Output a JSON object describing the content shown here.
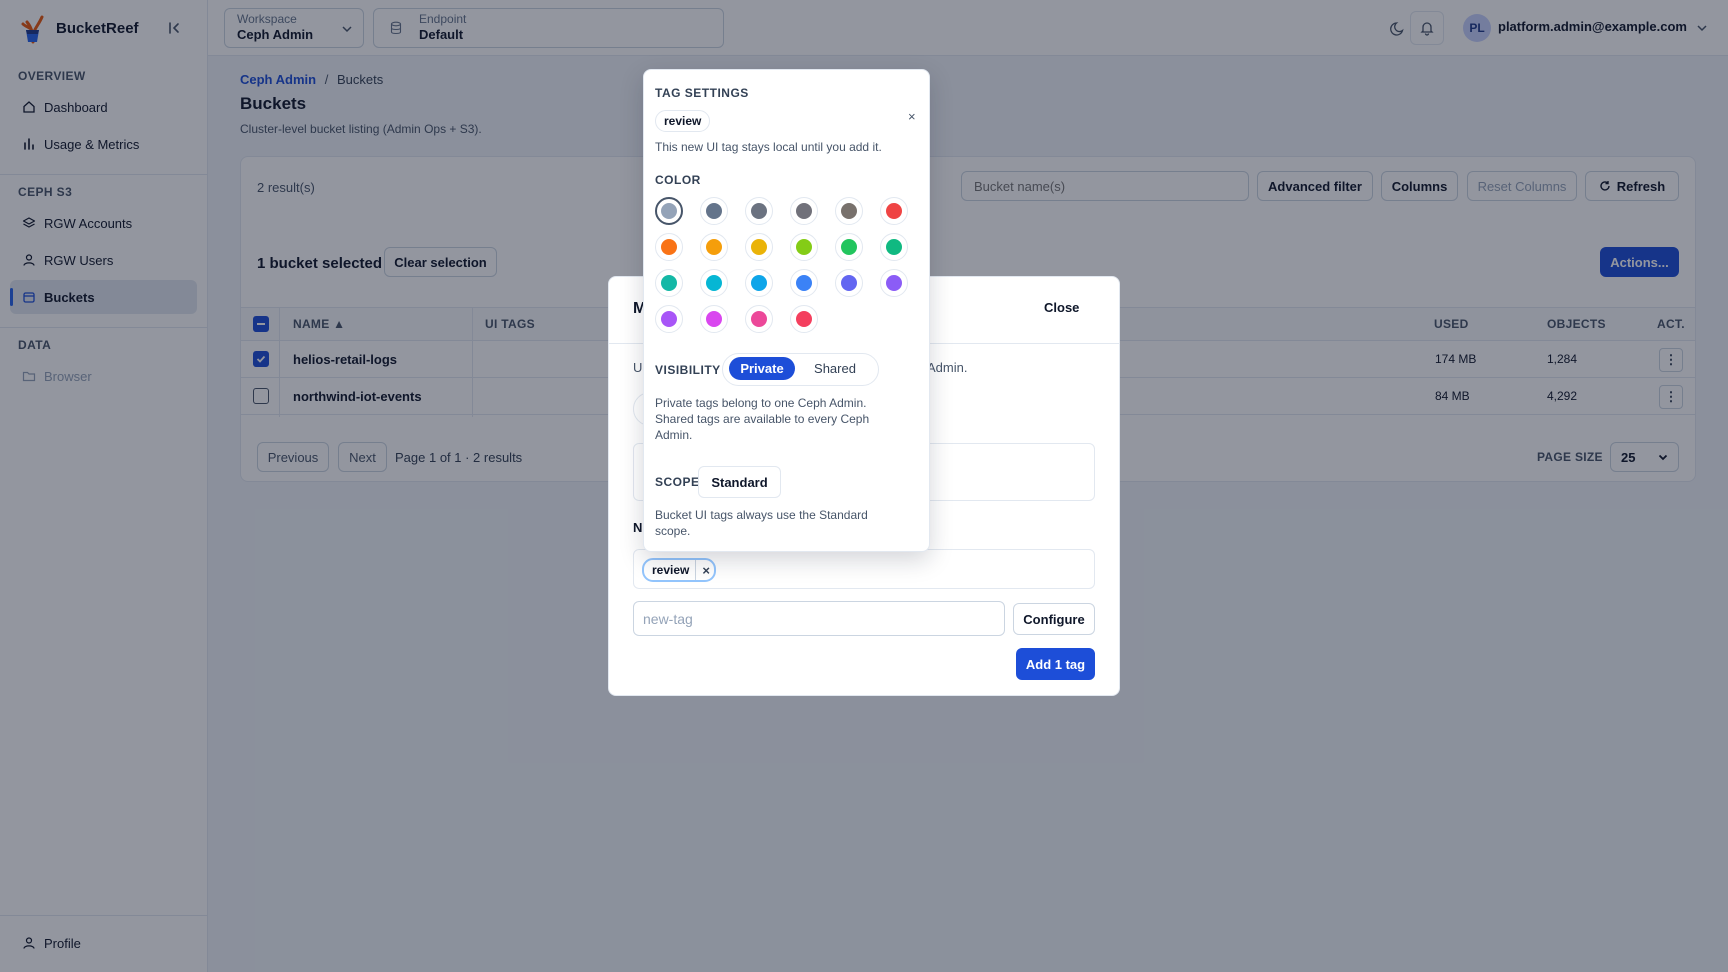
{
  "app": {
    "name": "BucketReef"
  },
  "sidebar": {
    "sections": [
      {
        "title": "OVERVIEW",
        "items": [
          {
            "label": "Dashboard"
          },
          {
            "label": "Usage & Metrics"
          }
        ]
      },
      {
        "title": "CEPH S3",
        "items": [
          {
            "label": "RGW Accounts"
          },
          {
            "label": "RGW Users"
          },
          {
            "label": "Buckets"
          }
        ]
      },
      {
        "title": "DATA",
        "items": [
          {
            "label": "Browser"
          }
        ]
      }
    ],
    "profile": "Profile"
  },
  "topbar": {
    "workspace": {
      "label": "Workspace",
      "value": "Ceph Admin"
    },
    "endpoint": {
      "label": "Endpoint",
      "value": "Default"
    },
    "user": {
      "initials": "PL",
      "email": "platform.admin@example.com"
    }
  },
  "page": {
    "breadcrumb": {
      "root": "Ceph Admin",
      "sep": "/",
      "current": "Buckets"
    },
    "title": "Buckets",
    "subtitle": "Cluster-level bucket listing (Admin Ops + S3)."
  },
  "toolbar": {
    "results": "2 result(s)",
    "search_placeholder": "Bucket name(s)",
    "advanced_filter": "Advanced filter",
    "columns": "Columns",
    "reset_columns": "Reset Columns",
    "refresh": "Refresh"
  },
  "selection": {
    "label": "1 bucket selected",
    "clear": "Clear selection",
    "actions": "Actions..."
  },
  "table": {
    "headers": {
      "name": "NAME ▲",
      "ui_tags": "UI TAGS",
      "used": "USED",
      "objects": "OBJECTS",
      "actions": "ACT."
    },
    "rows": [
      {
        "name": "helios-retail-logs",
        "used": "174 MB",
        "objects": "1,284",
        "selected": true
      },
      {
        "name": "northwind-iot-events",
        "used": "84 MB",
        "objects": "4,292",
        "selected": false
      }
    ]
  },
  "pagination": {
    "previous": "Previous",
    "next": "Next",
    "info": "Page 1 of 1 · 2 results",
    "page_size_label": "PAGE SIZE",
    "page_size": "25"
  },
  "modal": {
    "title_initial": "M",
    "close": "Close",
    "line_start": "U",
    "line_end": "Admin.",
    "new_heading_initial": "N",
    "pending_tag": "review",
    "input_placeholder": "new-tag",
    "configure": "Configure",
    "add": "Add 1 tag"
  },
  "popover": {
    "heading": "TAG SETTINGS",
    "tag": "review",
    "close": "×",
    "note": "This new UI tag stays local until you add it.",
    "color_heading": "COLOR",
    "colors": [
      "#94a3b8",
      "#64748b",
      "#6b7280",
      "#71717a",
      "#78716c",
      "#ef4444",
      "#f97316",
      "#f59e0b",
      "#eab308",
      "#84cc16",
      "#22c55e",
      "#10b981",
      "#14b8a6",
      "#06b6d4",
      "#0ea5e9",
      "#3b82f6",
      "#6366f1",
      "#8b5cf6",
      "#a855f7",
      "#d946ef",
      "#ec4899",
      "#f43f5e"
    ],
    "selected_color": "#94a3b8",
    "visibility_heading": "VISIBILITY",
    "visibility_options": [
      "Private",
      "Shared"
    ],
    "visibility_selected": "Private",
    "visibility_help": "Private tags belong to one Ceph Admin. Shared tags are available to every Ceph Admin.",
    "scope_heading": "SCOPE",
    "scope_value": "Standard",
    "scope_help": "Bucket UI tags always use the Standard scope."
  }
}
